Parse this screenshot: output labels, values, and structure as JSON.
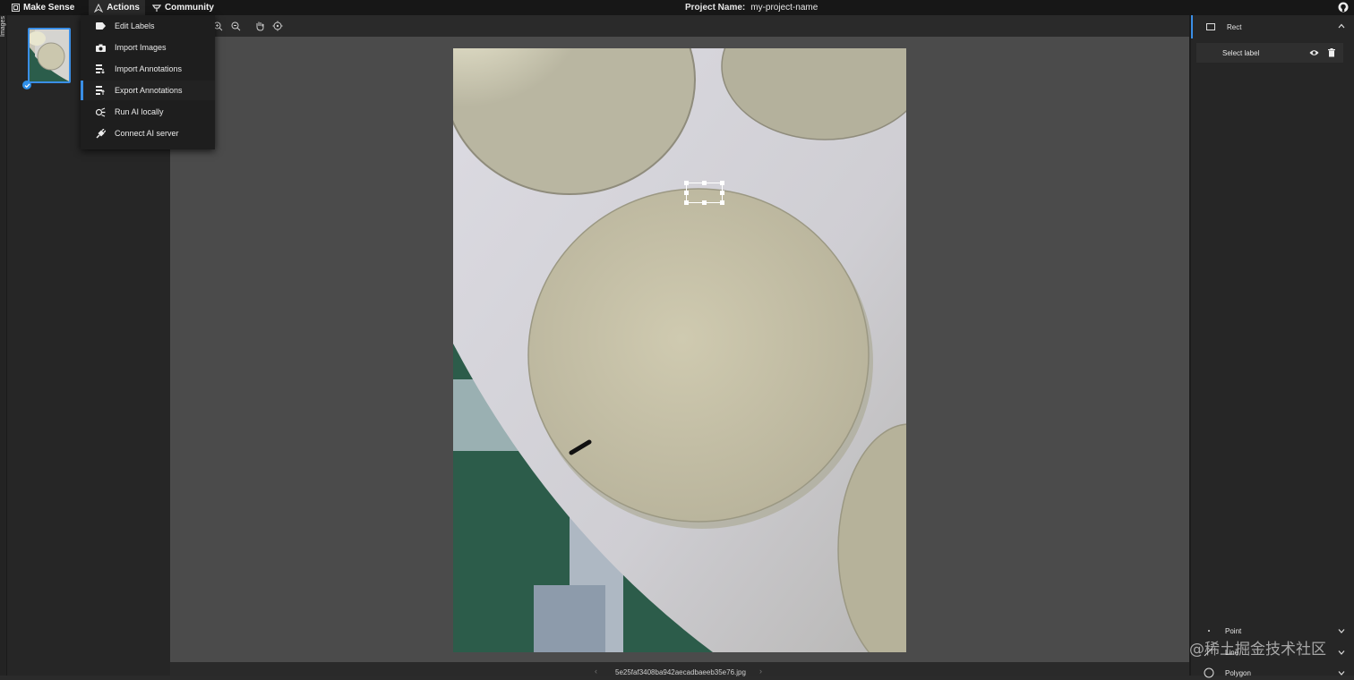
{
  "topbar": {
    "brand": "Make Sense",
    "actions": "Actions",
    "community": "Community",
    "project_label": "Project Name:",
    "project_name": "my-project-name"
  },
  "left_tab": {
    "label": "Images"
  },
  "menu": {
    "items": [
      {
        "label": "Edit Labels",
        "icon": "tag-icon"
      },
      {
        "label": "Import Images",
        "icon": "camera-icon"
      },
      {
        "label": "Import Annotations",
        "icon": "list-icon"
      },
      {
        "label": "Export Annotations",
        "icon": "list-icon"
      },
      {
        "label": "Run AI locally",
        "icon": "brain-icon"
      },
      {
        "label": "Connect AI server",
        "icon": "plug-icon"
      }
    ]
  },
  "bottom": {
    "filename": "5e25faf3408ba942aecadbaeeb35e76.jpg"
  },
  "right": {
    "rect_label": "Rect",
    "select_label": "Select label",
    "point": "Point",
    "line": "Line",
    "polygon": "Polygon"
  },
  "watermark": "@稀土掘金技术社区",
  "colors": {
    "accent": "#3a8ee6",
    "canvas": "#4b4b4b",
    "topbar": "#171717"
  }
}
